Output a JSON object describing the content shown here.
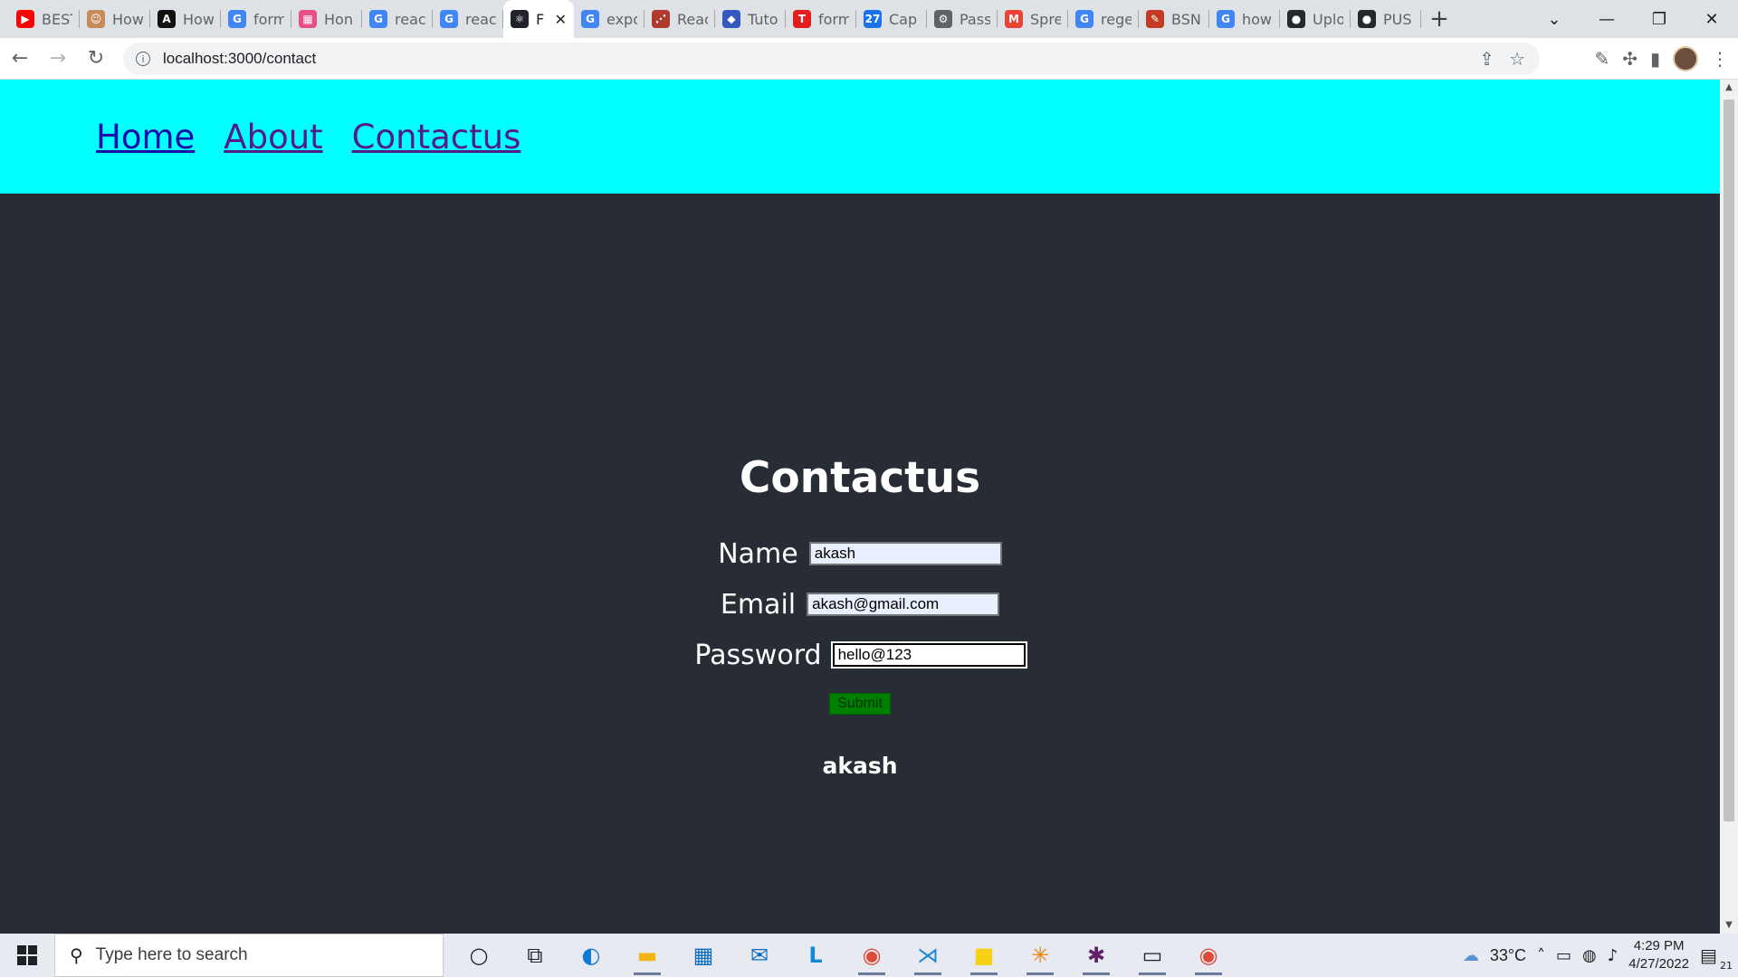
{
  "browser": {
    "tabs": [
      {
        "title": "BEST",
        "favicon_color": "#ff0000",
        "favicon_glyph": "▶"
      },
      {
        "title": "How",
        "favicon_color": "#c58c5a",
        "favicon_glyph": "☺"
      },
      {
        "title": "How",
        "favicon_color": "#111111",
        "favicon_glyph": "A"
      },
      {
        "title": "form",
        "favicon_color": "#4285f4",
        "favicon_glyph": "G"
      },
      {
        "title": "Hon",
        "favicon_color": "#e94f86",
        "favicon_glyph": "▦"
      },
      {
        "title": "reac",
        "favicon_color": "#4285f4",
        "favicon_glyph": "G"
      },
      {
        "title": "reac",
        "favicon_color": "#4285f4",
        "favicon_glyph": "G"
      },
      {
        "title": "F",
        "favicon_color": "#20232a",
        "favicon_glyph": "⚛",
        "active": true
      },
      {
        "title": "expo",
        "favicon_color": "#4285f4",
        "favicon_glyph": "G"
      },
      {
        "title": "Reac",
        "favicon_color": "#b03a2e",
        "favicon_glyph": "⋰"
      },
      {
        "title": "Tuto",
        "favicon_color": "#3457c0",
        "favicon_glyph": "◆"
      },
      {
        "title": "form",
        "favicon_color": "#e11d1d",
        "favicon_glyph": "T"
      },
      {
        "title": "Cap",
        "favicon_color": "#1a73e8",
        "favicon_glyph": "27"
      },
      {
        "title": "Pass",
        "favicon_color": "#5f6368",
        "favicon_glyph": "⚙"
      },
      {
        "title": "Spre",
        "favicon_color": "#ea4335",
        "favicon_glyph": "M"
      },
      {
        "title": "rege",
        "favicon_color": "#4285f4",
        "favicon_glyph": "G"
      },
      {
        "title": "BSN",
        "favicon_color": "#c23b22",
        "favicon_glyph": "✎"
      },
      {
        "title": "how",
        "favicon_color": "#4285f4",
        "favicon_glyph": "G"
      },
      {
        "title": "Uplo",
        "favicon_color": "#24292e",
        "favicon_glyph": "●"
      },
      {
        "title": "PUS",
        "favicon_color": "#24292e",
        "favicon_glyph": "●"
      }
    ],
    "url": "localhost:3000/contact"
  },
  "nav": {
    "home": "Home",
    "about": "About",
    "contact": "Contactus"
  },
  "page": {
    "heading": "Contactus",
    "name_label": "Name",
    "name_value": "akash",
    "email_label": "Email",
    "email_value": "akash@gmail.com",
    "password_label": "Password",
    "password_value": "hello@123",
    "submit_label": "Submit",
    "result_text": "akash"
  },
  "taskbar": {
    "search_placeholder": "Type here to search",
    "weather": "33°C",
    "time": "4:29 PM",
    "date": "4/27/2022",
    "notifications": "21"
  },
  "colors": {
    "navbar_bg": "#00ffff",
    "page_bg": "#282c34",
    "submit_bg": "#008000"
  }
}
